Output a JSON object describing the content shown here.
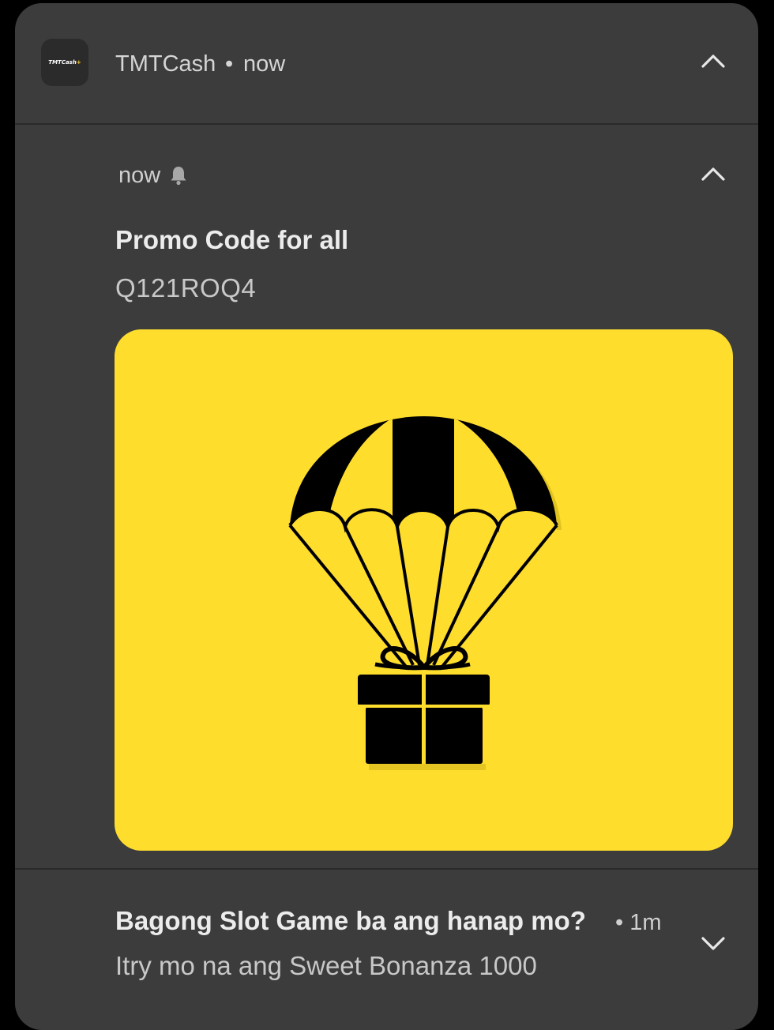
{
  "group_header": {
    "app_icon_text": "TMTCash",
    "app_icon_plus": "+",
    "app_name": "TMTCash",
    "separator": "•",
    "time": "now"
  },
  "notification_1": {
    "time": "now",
    "title": "Promo Code for all",
    "body": "Q121ROQ4",
    "image_icon": "parachute-gift-icon"
  },
  "notification_2": {
    "title": "Bagong Slot Game ba ang hanap mo?",
    "separator": "•",
    "time": "1m",
    "body": "Itry mo na ang Sweet Bonanza 1000"
  },
  "colors": {
    "card_background": "#3c3c3c",
    "page_background": "#000000",
    "image_background": "#fedd2d",
    "icon_black": "#000000",
    "title_text": "#ececec",
    "secondary_text": "#c8c8c8"
  }
}
